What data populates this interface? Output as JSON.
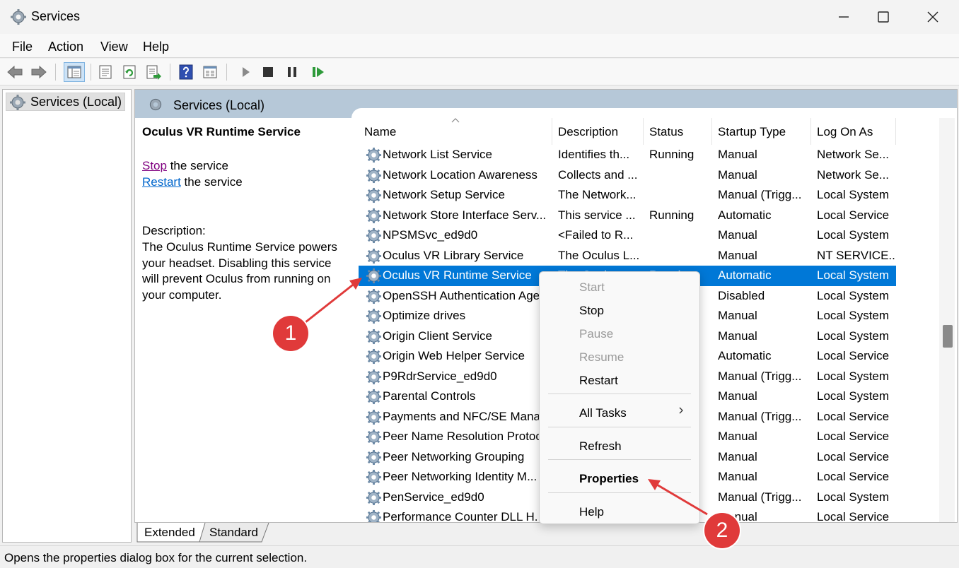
{
  "window": {
    "title": "Services",
    "icon": "gear-icon",
    "controls": [
      "minimize-icon",
      "maximize-icon",
      "close-icon"
    ]
  },
  "menu": [
    "File",
    "Action",
    "View",
    "Help"
  ],
  "toolbar_icons": [
    "back-icon",
    "forward-icon",
    "console-tree-icon",
    "properties-icon",
    "refresh-icon",
    "export-list-icon",
    "help-icon",
    "view-icon",
    "play-icon",
    "stop-icon",
    "pause-icon",
    "resume-icon"
  ],
  "left_pane": {
    "tree_item": "Services (Local)"
  },
  "right_pane": {
    "header": "Services (Local)",
    "extended": {
      "service_title": "Oculus VR Runtime Service",
      "stop_link": "Stop",
      "stop_suffix": " the service",
      "restart_link": "Restart",
      "restart_suffix": " the service",
      "description_label": "Description:",
      "description_text": "The Oculus Runtime Service powers your headset. Disabling this service will prevent Oculus from running on your computer."
    },
    "columns": [
      "Name",
      "Description",
      "Status",
      "Startup Type",
      "Log On As"
    ],
    "rows": [
      {
        "name": "Network List Service",
        "description": "Identifies th...",
        "status": "Running",
        "startup": "Manual",
        "logon": "Network Se..."
      },
      {
        "name": "Network Location Awareness",
        "description": "Collects and ...",
        "status": "",
        "startup": "Manual",
        "logon": "Network Se..."
      },
      {
        "name": "Network Setup Service",
        "description": "The Network...",
        "status": "",
        "startup": "Manual (Trigg...",
        "logon": "Local System"
      },
      {
        "name": "Network Store Interface Serv...",
        "description": "This service ...",
        "status": "Running",
        "startup": "Automatic",
        "logon": "Local Service"
      },
      {
        "name": "NPSMSvc_ed9d0",
        "description": "<Failed to R...",
        "status": "",
        "startup": "Manual",
        "logon": "Local System"
      },
      {
        "name": "Oculus VR Library Service",
        "description": "The Oculus L...",
        "status": "",
        "startup": "Manual",
        "logon": "NT SERVICE..."
      },
      {
        "name": "Oculus VR Runtime Service",
        "description": "The Oculus ...",
        "status": "Running",
        "startup": "Automatic",
        "logon": "Local System",
        "selected": true
      },
      {
        "name": "OpenSSH Authentication Agent",
        "description": "",
        "status": "",
        "startup": "Disabled",
        "logon": "Local System"
      },
      {
        "name": "Optimize drives",
        "description": "",
        "status": "",
        "startup": "Manual",
        "logon": "Local System"
      },
      {
        "name": "Origin Client Service",
        "description": "",
        "status": "",
        "startup": "Manual",
        "logon": "Local System"
      },
      {
        "name": "Origin Web Helper Service",
        "description": "",
        "status": "",
        "startup": "Automatic",
        "logon": "Local Service"
      },
      {
        "name": "P9RdrService_ed9d0",
        "description": "",
        "status": "",
        "startup": "Manual (Trigg...",
        "logon": "Local System"
      },
      {
        "name": "Parental Controls",
        "description": "",
        "status": "",
        "startup": "Manual",
        "logon": "Local System"
      },
      {
        "name": "Payments and NFC/SE Manager",
        "description": "",
        "status": "",
        "startup": "Manual (Trigg...",
        "logon": "Local Service"
      },
      {
        "name": "Peer Name Resolution Protocol",
        "description": "",
        "status": "",
        "startup": "Manual",
        "logon": "Local Service"
      },
      {
        "name": "Peer Networking Grouping",
        "description": "",
        "status": "",
        "startup": "Manual",
        "logon": "Local Service"
      },
      {
        "name": "Peer Networking Identity M...",
        "description": "",
        "status": "",
        "startup": "Manual",
        "logon": "Local Service"
      },
      {
        "name": "PenService_ed9d0",
        "description": "",
        "status": "",
        "startup": "Manual (Trigg...",
        "logon": "Local System"
      },
      {
        "name": "Performance Counter DLL H...",
        "description": "",
        "status": "",
        "startup": "Manual",
        "logon": "Local Service"
      }
    ]
  },
  "tabs": [
    "Extended",
    "Standard"
  ],
  "status_text": "Opens the properties dialog box for the current selection.",
  "context_menu": [
    {
      "label": "Start",
      "disabled": true
    },
    {
      "label": "Stop"
    },
    {
      "label": "Pause",
      "disabled": true
    },
    {
      "label": "Resume",
      "disabled": true
    },
    {
      "label": "Restart"
    },
    {
      "label": "All Tasks",
      "submenu": true
    },
    {
      "label": "Refresh"
    },
    {
      "label": "Properties",
      "bold": true
    },
    {
      "label": "Help"
    }
  ],
  "callouts": [
    "1",
    "2"
  ],
  "colors": {
    "selection": "#0078d7",
    "callout": "#e03a3a",
    "header_band": "#b6c8d8",
    "visited_link": "#800080",
    "link": "#0066cc"
  }
}
